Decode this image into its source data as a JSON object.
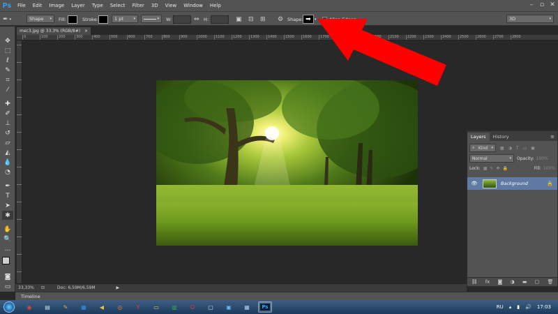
{
  "app": {
    "logo_text": "Ps"
  },
  "menu": [
    "File",
    "Edit",
    "Image",
    "Layer",
    "Type",
    "Select",
    "Filter",
    "3D",
    "View",
    "Window",
    "Help"
  ],
  "window_controls": {
    "minimize": "–",
    "restore": "▫",
    "close": "✕"
  },
  "options": {
    "mode_value": "Shape",
    "fill_label": "Fill:",
    "stroke_label": "Stroke:",
    "stroke_width_value": "1 pt",
    "width_label": "W:",
    "height_label": "H:",
    "shape_label": "Shape:",
    "align_edges_label": "Align Edges",
    "align_edges_checked": false,
    "workspace_value": "3D"
  },
  "document": {
    "tab_title": "mec3.jpg @ 33.3% (RGB/8#)",
    "close_glyph": "×",
    "ruler_ticks": [
      "0",
      "100",
      "200",
      "300",
      "400",
      "500",
      "600",
      "700",
      "800",
      "900",
      "1000",
      "1100",
      "1200",
      "1300",
      "1400",
      "1500",
      "1600",
      "1700",
      "1800",
      "1900",
      "2000",
      "2100",
      "2200",
      "2300",
      "2400",
      "2500",
      "2600",
      "2700",
      "2800"
    ]
  },
  "status": {
    "zoom": "33,33%",
    "doc_size": "Doc: 6,59M/6,59M"
  },
  "timeline": {
    "label": "Timeline"
  },
  "layers_panel": {
    "tabs": [
      "Layers",
      "History"
    ],
    "kind_value": "Kind",
    "blend_mode": "Normal",
    "opacity_label": "Opacity:",
    "opacity_value": "100%",
    "lock_label": "Lock:",
    "fill_label": "Fill:",
    "fill_value": "100%",
    "layers": [
      {
        "name": "Background",
        "visible": true,
        "locked": true
      }
    ]
  },
  "taskbar": {
    "apps": [
      {
        "name": "chrome",
        "glyph": "◉",
        "color": "#e94235"
      },
      {
        "name": "notepad",
        "glyph": "▤",
        "color": "#c8d8ea"
      },
      {
        "name": "paint",
        "glyph": "✎",
        "color": "#e9a43a"
      },
      {
        "name": "media",
        "glyph": "▦",
        "color": "#3a8ee9"
      },
      {
        "name": "player",
        "glyph": "◀",
        "color": "#f0c030"
      },
      {
        "name": "firefox",
        "glyph": "◎",
        "color": "#f07a22"
      },
      {
        "name": "yandex",
        "glyph": "Y",
        "color": "#ff3333"
      },
      {
        "name": "folder",
        "glyph": "▭",
        "color": "#f0c95a"
      },
      {
        "name": "excel",
        "glyph": "▥",
        "color": "#3aa856"
      },
      {
        "name": "opera",
        "glyph": "O",
        "color": "#ff2a2a"
      },
      {
        "name": "notes",
        "glyph": "▢",
        "color": "#dddddd"
      },
      {
        "name": "explorer",
        "glyph": "▣",
        "color": "#6ab0ea"
      },
      {
        "name": "calc",
        "glyph": "▦",
        "color": "#aaccee"
      },
      {
        "name": "photoshop",
        "glyph": "Ps",
        "color": "#31a8ff"
      }
    ],
    "language": "RU",
    "time": "17:03"
  },
  "colors": {
    "accent_red": "#ff0000",
    "ps_blue": "#31a8ff",
    "selected_layer": "#5f7ba3"
  }
}
